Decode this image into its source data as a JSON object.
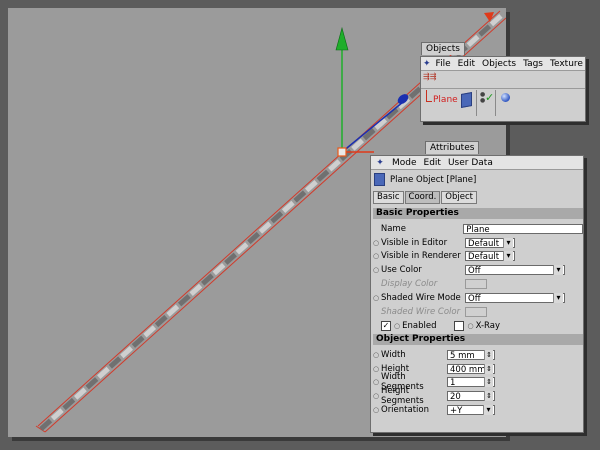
{
  "objects_panel": {
    "tab": "Objects",
    "menu": [
      "File",
      "Edit",
      "Objects",
      "Tags",
      "Texture"
    ],
    "object_name": "Plane"
  },
  "attributes_panel": {
    "tab": "Attributes",
    "menu": [
      "Mode",
      "Edit",
      "User Data"
    ],
    "title": "Plane Object [Plane]",
    "subtabs": [
      "Basic",
      "Coord.",
      "Object"
    ],
    "basic_header": "Basic Properties",
    "basic": {
      "name_label": "Name",
      "name_value": "Plane",
      "vis_editor_label": "Visible in Editor",
      "vis_editor_value": "Default",
      "vis_render_label": "Visible in Renderer",
      "vis_render_value": "Default",
      "use_color_label": "Use Color",
      "use_color_value": "Off",
      "display_color_label": "Display Color",
      "shaded_wire_mode_label": "Shaded Wire Mode",
      "shaded_wire_mode_value": "Off",
      "shaded_wire_color_label": "Shaded Wire Color",
      "enabled_label": "Enabled",
      "xray_label": "X-Ray"
    },
    "object_header": "Object Properties",
    "object": {
      "width_label": "Width",
      "width_value": "5 mm",
      "height_label": "Height",
      "height_value": "400 mm",
      "wseg_label": "Width Segments",
      "wseg_value": "1",
      "hseg_label": "Height Segments",
      "hseg_value": "20",
      "orient_label": "Orientation",
      "orient_value": "+Y"
    }
  },
  "colors": {
    "viewport_bg": "#9b9b9b",
    "axis_y": "#1fae2b",
    "axis_x": "#e03a1a",
    "axis_z": "#1a2fb0"
  },
  "icons": [
    "cinema-logo-icon",
    "plane-object-icon",
    "checkmark-icon",
    "material-sphere-icon",
    "hierarchy-icon"
  ]
}
